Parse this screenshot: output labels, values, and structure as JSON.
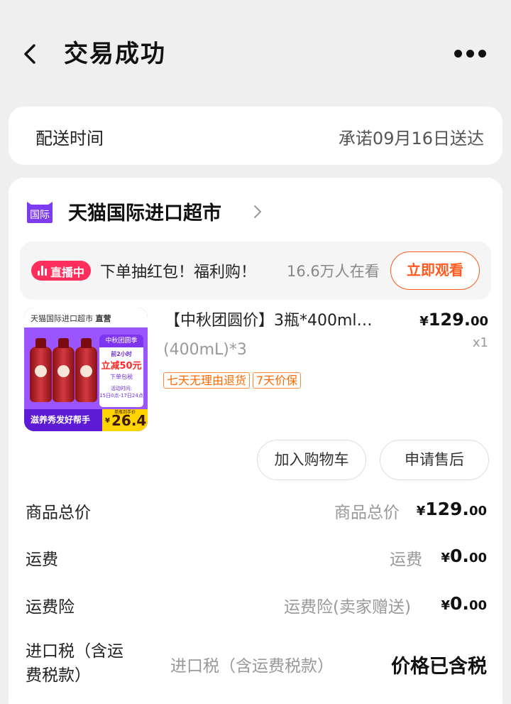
{
  "header": {
    "title": "交易成功",
    "back_icon": "chevron-left-icon",
    "more_icon": "more-dots-icon"
  },
  "delivery": {
    "label": "配送时间",
    "value": "承诺09月16日送达"
  },
  "shop": {
    "logo_text": "国际",
    "logo_color": "#7d3cf0",
    "name": "天猫国际进口超市",
    "chevron_icon": "chevron-right-icon"
  },
  "live": {
    "badge": "直播中",
    "badge_color": "#ff2e5a",
    "text": "下单抽红包！福利购！",
    "viewers": "16.6万人在看",
    "button": "立即观看",
    "accent_color": "#ff5a1f"
  },
  "item": {
    "thumb": {
      "top_text": "天猫国际进口超市",
      "top_badge": "直营",
      "card_header": "中秋团圆季",
      "card_line1": "前2小时",
      "card_line2": "立减50元",
      "card_line3": "下单包税",
      "card_line4a": "活动时间:",
      "card_line4b": "15日0点-17日24点",
      "slogan": "滋养秀发好帮手",
      "price_label": "单瓶到手价",
      "price_yen": "¥",
      "price": "26.4"
    },
    "title": "【中秋团圆价】3瓶*400ml…",
    "spec": "(400mL)*3",
    "tags": [
      "七天无理由退货",
      "7天价保"
    ],
    "price_yen": "¥",
    "price_int": "129.",
    "price_dec": "00",
    "qty": "x1"
  },
  "actions": {
    "add_cart": "加入购物车",
    "after_sale": "申请售后"
  },
  "summary": [
    {
      "label": "商品总价",
      "mid": "商品总价",
      "yen": "¥",
      "int": "129.",
      "dec": "00"
    },
    {
      "label": "运费",
      "mid": "运费",
      "yen": "¥",
      "int": "0.",
      "dec": "00"
    },
    {
      "label": "运费险",
      "mid": "运费险(卖家赠送)",
      "yen": "¥",
      "int": "0.",
      "dec": "00"
    }
  ],
  "tax": {
    "label_line1": "进口税（含运",
    "label_line2": "费税款）",
    "mid": "进口税（含运费税款）",
    "value": "价格已含税"
  }
}
